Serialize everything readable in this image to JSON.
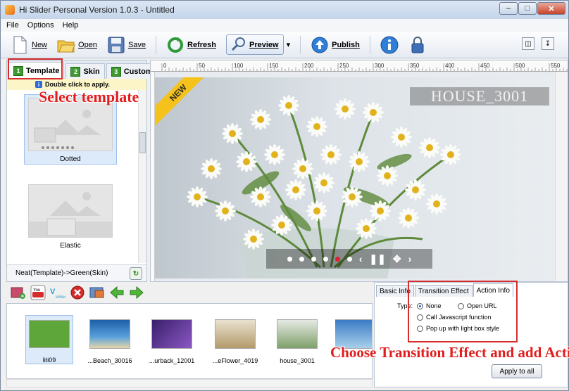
{
  "window": {
    "title": "Hi Slider Personal Version 1.0.3  -  Untitled"
  },
  "menu": {
    "items": [
      "File",
      "Options",
      "Help"
    ]
  },
  "toolbar": {
    "new": "New",
    "open": "Open",
    "save": "Save",
    "refresh": "Refresh",
    "preview": "Preview",
    "publish": "Publish"
  },
  "left": {
    "tabs": [
      {
        "num": "1",
        "label": "Template"
      },
      {
        "num": "2",
        "label": "Skin"
      },
      {
        "num": "3",
        "label": "Custom"
      }
    ],
    "hint": "Double click to apply.",
    "templates": [
      "Dotted",
      "Elastic"
    ],
    "status": "Neat(Template)->Green(Skin)"
  },
  "annotations": {
    "select_template": "Select template",
    "choose_transition": "Choose Transition Effect and add Action"
  },
  "stage": {
    "ribbon": "NEW",
    "watermark": "HOUSE_3001",
    "dots_total": 6,
    "active_dot_index": 4
  },
  "ruler_labels": [
    "0",
    "50",
    "100",
    "150",
    "200",
    "250",
    "300",
    "350",
    "400",
    "450",
    "500",
    "550"
  ],
  "gallery": [
    {
      "label": "liti09",
      "color": "#5ea63a"
    },
    {
      "label": "...Beach_30016",
      "color": "#2f6fb3"
    },
    {
      "label": "...urback_12001",
      "color": "#6b3f9c"
    },
    {
      "label": "...eFlower_4019",
      "color": "#c9b58a"
    },
    {
      "label": "house_3001",
      "color": "#b8c2b4"
    },
    {
      "label": "",
      "color": "#3c7cc4"
    }
  ],
  "props": {
    "tabs": [
      "Basic Info",
      "Transition Effect",
      "Action Info"
    ],
    "type_label": "Type:",
    "options": [
      "None",
      "Open URL",
      "Call Javascript function",
      "Pop up with light box style"
    ],
    "apply": "Apply to all"
  },
  "colors": {
    "accent_red": "#d62e2e",
    "green": "#3c9a2f"
  }
}
